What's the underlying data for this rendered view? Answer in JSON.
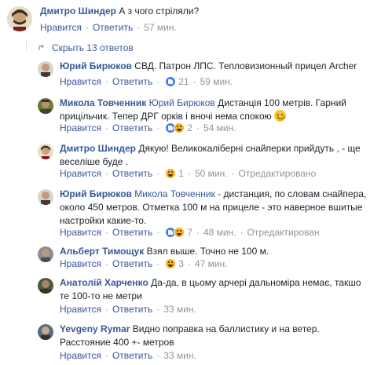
{
  "top_comment": {
    "author": "Дмитро Шиндер",
    "text": "А з чого стріляли?",
    "like_label": "Нравится",
    "reply_label": "Ответить",
    "time": "57 мин."
  },
  "hide_replies": "Скрыть 13 ответов",
  "replies": [
    {
      "author": "Юрий Бирюков",
      "text": "СВД. Патрон ЛПС. Тепловизионный прицел Archer",
      "like_label": "Нравится",
      "reply_label": "Ответить",
      "reaction_count": "21",
      "time": "59 мин."
    },
    {
      "author": "Микола Товченник",
      "mention": "Юрий Бирюков",
      "text_line1": "Дистанція 100 метрів. Гарний",
      "text_line2": "прицільчик. Тепер ДРГ орків і вночі нема спокою",
      "like_label": "Нравится",
      "reply_label": "Ответить",
      "reaction_count": "2",
      "time": "54 мин."
    },
    {
      "author": "Дмитро Шиндер",
      "text_line1": "Дякую! Великокаліберні снайперки прийдуть , - ще",
      "text_line2": "веселіше буде .",
      "like_label": "Нравится",
      "reply_label": "Ответить",
      "reaction_count": "1",
      "time": "50 мин.",
      "edited": "Отредактировано"
    },
    {
      "author": "Юрий Бирюков",
      "mention": "Микола Товченник",
      "text_line1": "- дистанция, по словам снайпера,",
      "text_line2": "около 450 метров. Отметка 100 м на прицеле - это наверное вшитые",
      "text_line3": "настройки какие-то.",
      "like_label": "Нравится",
      "reply_label": "Ответить",
      "reaction_count": "7",
      "time": "48 мин.",
      "edited": "Отредактирован"
    },
    {
      "author": "Альберт Тимощук",
      "text": "Взял выше. Точно не 100 м.",
      "like_label": "Нравится",
      "reply_label": "Ответить",
      "reaction_count": "3",
      "time": "47 мин."
    },
    {
      "author": "Анатолій Харченко",
      "text_line1": "Да-да, в цьому арчері дальноміра немає, такшо",
      "text_line2": "те 100-то не метри",
      "like_label": "Нравится",
      "reply_label": "Ответить",
      "time": "33 мин."
    },
    {
      "author": "Yevgeny Rymar",
      "text_line1": "Видно поправка на баллистику и на ветер.",
      "text_line2": "Расстояние 400 +- метров",
      "like_label": "Нравится",
      "reply_label": "Ответить",
      "time": "33 мин."
    }
  ]
}
